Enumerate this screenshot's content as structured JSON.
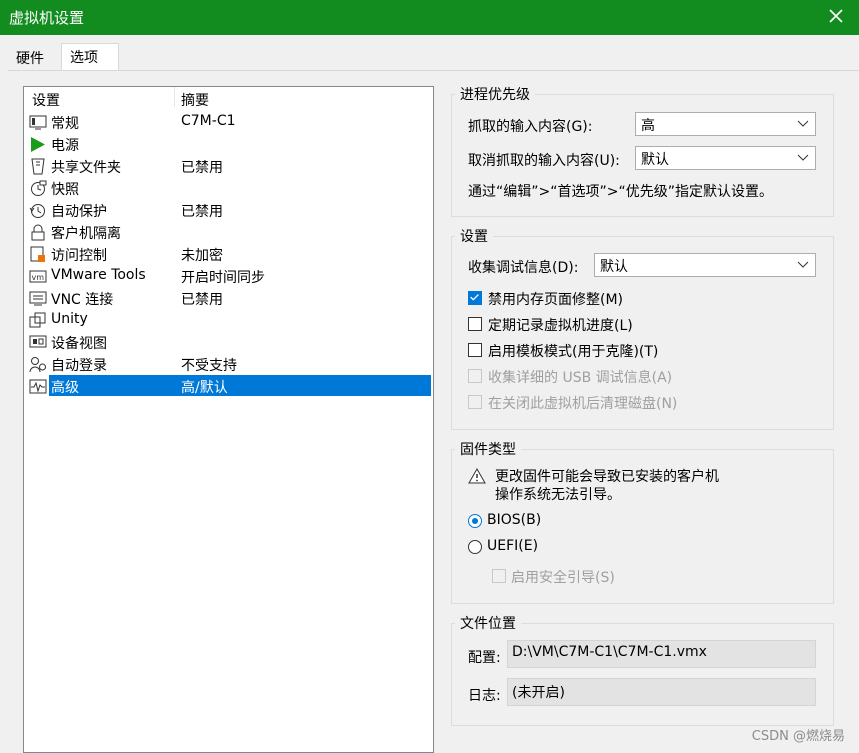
{
  "window": {
    "title": "虚拟机设置",
    "close_label": "关闭"
  },
  "tabs": [
    {
      "label": "硬件"
    },
    {
      "label": "选项"
    }
  ],
  "settings_list": {
    "col_setting": "设置",
    "col_summary": "摘要",
    "rows": [
      {
        "name": "常规",
        "summary": "C7M-C1",
        "icon": "general-icon"
      },
      {
        "name": "电源",
        "summary": "",
        "icon": "power-icon"
      },
      {
        "name": "共享文件夹",
        "summary": "已禁用",
        "icon": "shared-folder-icon"
      },
      {
        "name": "快照",
        "summary": "",
        "icon": "snapshot-icon"
      },
      {
        "name": "自动保护",
        "summary": "已禁用",
        "icon": "autoprotect-icon"
      },
      {
        "name": "客户机隔离",
        "summary": "",
        "icon": "lock-icon"
      },
      {
        "name": "访问控制",
        "summary": "未加密",
        "icon": "access-control-icon"
      },
      {
        "name": "VMware Tools",
        "summary": "开启时间同步",
        "icon": "vmware-tools-icon"
      },
      {
        "name": "VNC 连接",
        "summary": "已禁用",
        "icon": "vnc-icon"
      },
      {
        "name": "Unity",
        "summary": "",
        "icon": "unity-icon"
      },
      {
        "name": "设备视图",
        "summary": "",
        "icon": "device-view-icon"
      },
      {
        "name": "自动登录",
        "summary": "不受支持",
        "icon": "autologin-icon"
      },
      {
        "name": "高级",
        "summary": "高/默认",
        "icon": "advanced-icon"
      }
    ]
  },
  "priority": {
    "title": "进程优先级",
    "grabbed_label": "抓取的输入内容(G):",
    "grabbed_value": "高",
    "ungrabbed_label": "取消抓取的输入内容(U):",
    "ungrabbed_value": "默认",
    "note": "通过“编辑”>“首选项”>“优先级”指定默认设置。"
  },
  "settings": {
    "title": "设置",
    "debug_label": "收集调试信息(D):",
    "debug_value": "默认",
    "options": [
      {
        "label": "禁用内存页面修整(M)",
        "checked": true,
        "disabled": false
      },
      {
        "label": "定期记录虚拟机进度(L)",
        "checked": false,
        "disabled": false
      },
      {
        "label": "启用模板模式(用于克隆)(T)",
        "checked": false,
        "disabled": false
      },
      {
        "label": "收集详细的 USB 调试信息(A)",
        "checked": false,
        "disabled": true
      },
      {
        "label": "在关闭此虚拟机后清理磁盘(N)",
        "checked": false,
        "disabled": true
      }
    ]
  },
  "firmware": {
    "title": "固件类型",
    "warning_line1": "更改固件可能会导致已安装的客户机",
    "warning_line2": "操作系统无法引导。",
    "bios_label": "BIOS(B)",
    "uefi_label": "UEFI(E)",
    "secure_boot_label": "启用安全引导(S)",
    "selected": "BIOS"
  },
  "file_location": {
    "title": "文件位置",
    "config_label": "配置:",
    "config_value": "D:\\VM\\C7M-C1\\C7M-C1.vmx",
    "log_label": "日志:",
    "log_value": "(未开启)"
  },
  "watermark": "CSDN @燃烧易",
  "colors": {
    "titlebar": "#128c1f",
    "selection": "#0078d7"
  }
}
